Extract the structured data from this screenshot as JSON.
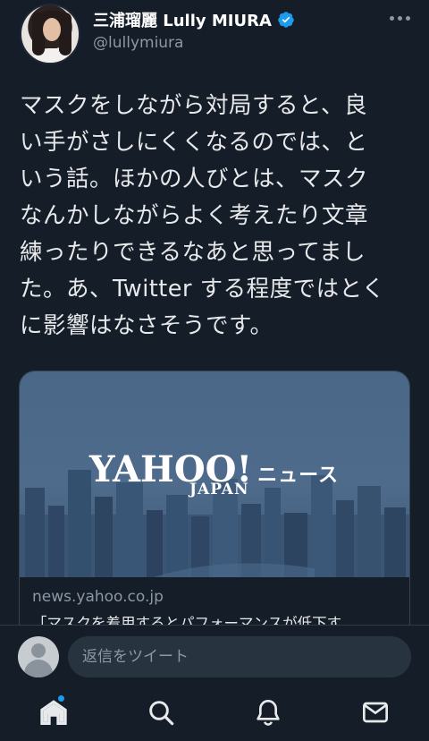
{
  "author": {
    "display_name": "三浦瑠麗 Lully MIURA",
    "handle": "@lullymiura",
    "verified_icon": "verified-badge-icon",
    "verified_color": "#1d9bf0"
  },
  "more_icon": "more-horizontal-icon",
  "tweet": {
    "text": "マスクをしながら対局すると、良\nい手がさしにくくなるのでは、と\nいう話。ほかの人びとは、マスク\nなんかしながらよく考えたり文章\n練ったりできるなあと思ってまし\nた。あ、Twitter する程度ではとく\nに影響はなさそうです。"
  },
  "card": {
    "logo_text": "YAHOO!",
    "logo_subtext": "JAPAN",
    "logo_news": "ニュース",
    "domain": "news.yahoo.co.jp",
    "title": "「マスクを着用するとパフォーマンスが低下す"
  },
  "reply": {
    "placeholder": "返信をツイート"
  },
  "tabs": [
    {
      "name": "home-icon",
      "active": true,
      "notification_dot": true
    },
    {
      "name": "search-icon",
      "active": false
    },
    {
      "name": "notifications-icon",
      "active": false
    },
    {
      "name": "messages-icon",
      "active": false
    }
  ],
  "colors": {
    "background": "#151d29",
    "text": "#e7e9ea",
    "secondary_text": "#8b98a5",
    "accent": "#1d9bf0"
  }
}
